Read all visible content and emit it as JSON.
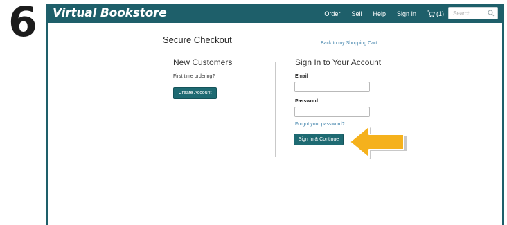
{
  "step_number": "6",
  "navbar": {
    "brand": "Virtual Bookstore",
    "links": [
      "Order",
      "Sell",
      "Help",
      "Sign In"
    ],
    "cart_label": "(1)",
    "search_placeholder": "Search"
  },
  "checkout": {
    "title": "Secure Checkout",
    "back_link": "Back to my Shopping Cart",
    "new_customers": {
      "title": "New Customers",
      "subtitle": "First time ordering?",
      "button": "Create Account"
    },
    "sign_in": {
      "title": "Sign In to Your Account",
      "email_label": "Email",
      "email_value": "",
      "password_label": "Password",
      "password_value": "",
      "forgot_link": "Forgot your password?",
      "button": "Sign In & Continue"
    }
  },
  "colors": {
    "navbar": "#1e5f6a",
    "button": "#1e6a72",
    "link": "#3b7fa8",
    "arrow": "#f5b11c"
  },
  "icons": [
    "cart-icon",
    "search-icon",
    "arrow-pointer-icon"
  ]
}
